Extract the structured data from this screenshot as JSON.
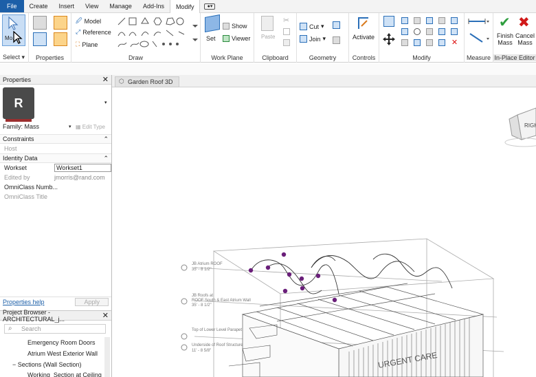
{
  "tabs": [
    "File",
    "Create",
    "Insert",
    "View",
    "Manage",
    "Add-Ins",
    "Modify"
  ],
  "ribbon": {
    "select_label": "Select",
    "select_btn": "Mo...",
    "properties_label": "Properties",
    "draw": {
      "label": "Draw",
      "model": "Model",
      "reference": "Reference",
      "plane": "Plane"
    },
    "workplane": {
      "label": "Work Plane",
      "set": "Set",
      "show": "Show",
      "viewer": "Viewer"
    },
    "clipboard": {
      "label": "Clipboard",
      "paste": "Paste"
    },
    "geometry": {
      "label": "Geometry",
      "cut": "Cut",
      "join": "Join"
    },
    "controls": {
      "label": "Controls",
      "activate": "Activate"
    },
    "modify": {
      "label": "Modify"
    },
    "measure": {
      "label": "Measure"
    },
    "inplace": {
      "label": "In-Place Editor",
      "finish": "Finish Mass",
      "cancel": "Cancel Mass"
    }
  },
  "properties": {
    "title": "Properties",
    "type_letter": "R",
    "family": "Family: Mass",
    "edit_type": "Edit Type",
    "constraints": "Constraints",
    "host": "Host",
    "identity": "Identity Data",
    "workset_k": "Workset",
    "workset_v": "Workset1",
    "edited_k": "Edited by",
    "edited_v": "jmorris@rand.com",
    "omni_num": "OmniClass Numb...",
    "omni_title": "OmniClass Title",
    "help": "Properties help",
    "apply": "Apply"
  },
  "browser": {
    "title": "Project Browser - ARCHITECTURAL_j...",
    "search": "Search",
    "items": [
      "Emergency Room Doors",
      "Atrium West Exterior Wall",
      "Sections (Wall Section)",
      "Working_Section at Ceiling"
    ]
  },
  "view": {
    "tab": "Garden Roof 3D",
    "cube": "RIGHT",
    "labels": [
      "JB Atrium ROOF",
      "35' - 8 1/2\"",
      "JB Roofs at",
      "ROOF South & East Atrium Wall",
      "35' - 8 1/2\"",
      "Top of Lower Level Parapet",
      "Underside of Roof Structure",
      "11' - 8 5/8\""
    ],
    "sign": "URGENT CARE"
  },
  "colors": {
    "file_tab": "#1c5fa8",
    "accent": "#c9def5",
    "finish": "#2e9e3e",
    "cancel": "#d11a1a",
    "spline_point": "#6a1f7a"
  }
}
